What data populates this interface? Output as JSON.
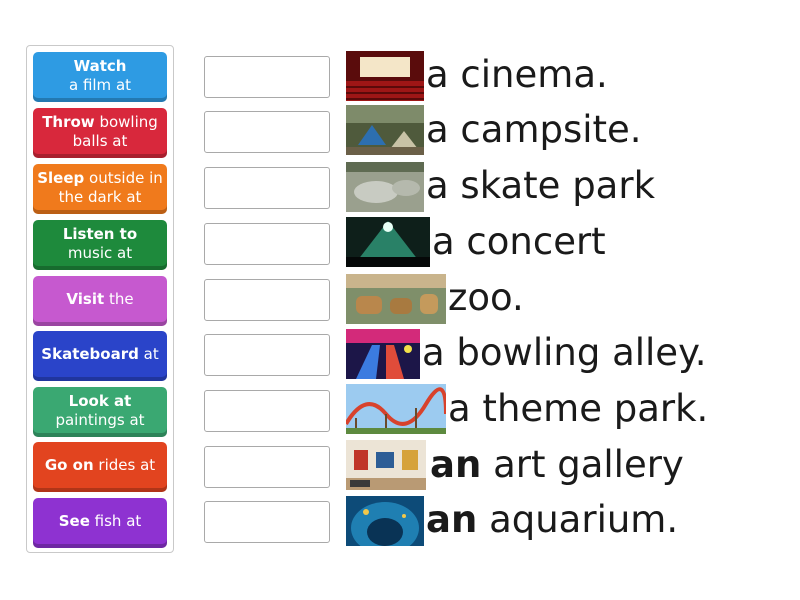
{
  "tiles": [
    {
      "bold": "Watch",
      "rest": "a film at",
      "color": "#2e9be3"
    },
    {
      "bold": "Throw",
      "rest": "bowling balls at",
      "color": "#d8283c"
    },
    {
      "bold": "Sleep",
      "rest": "outside in the dark at",
      "color": "#f07a1c"
    },
    {
      "bold": "Listen to",
      "rest": "music at",
      "color": "#1e8a3c"
    },
    {
      "bold": "Visit",
      "rest": "the",
      "color": "#c659cf"
    },
    {
      "bold": "Skateboard",
      "rest": "at",
      "color": "#2a44c9"
    },
    {
      "bold": "Look at",
      "rest": "paintings at",
      "color": "#3aa872"
    },
    {
      "bold": "Go on",
      "rest": "rides at",
      "color": "#e2441f"
    },
    {
      "bold": "See",
      "rest": "fish at",
      "color": "#8e32d1"
    }
  ],
  "answers": [
    {
      "bold": "",
      "rest": "a cinema.",
      "image": "cinema-image"
    },
    {
      "bold": "",
      "rest": "a campsite.",
      "image": "campsite-image"
    },
    {
      "bold": "",
      "rest": "a skate park",
      "image": "skate-park-image"
    },
    {
      "bold": "",
      "rest": "a concert",
      "image": "concert-image"
    },
    {
      "bold": "",
      "rest": "zoo.",
      "image": "zoo-image"
    },
    {
      "bold": "",
      "rest": "a bowling alley.",
      "image": "bowling-alley-image"
    },
    {
      "bold": "",
      "rest": "a theme park.",
      "image": "theme-park-image"
    },
    {
      "bold": "an",
      "rest": " art gallery",
      "image": "art-gallery-image"
    },
    {
      "bold": "an",
      "rest": " aquarium.",
      "image": "aquarium-image"
    }
  ]
}
